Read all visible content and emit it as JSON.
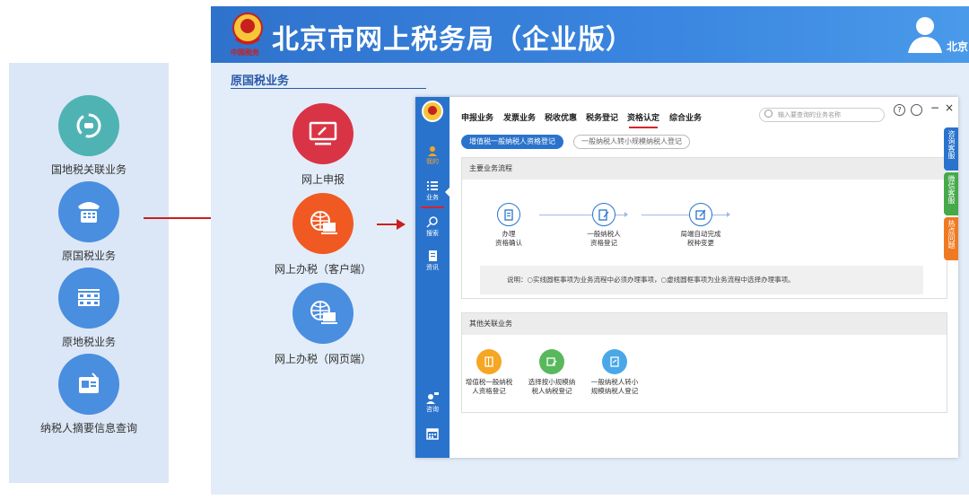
{
  "left_panel": {
    "items": [
      {
        "label": "国地税关联业务",
        "icon": "link-arrows-icon",
        "color": "#4fb3b3"
      },
      {
        "label": "原国税业务",
        "icon": "phone-keypad-icon",
        "color": "#4a8ee0"
      },
      {
        "label": "原地税业务",
        "icon": "grid-icon",
        "color": "#4a8ee0"
      },
      {
        "label": "纳税人摘要信息查询",
        "icon": "id-card-icon",
        "color": "#4a8ee0"
      }
    ]
  },
  "portal": {
    "title": "北京市网上税务局（企业版）",
    "emblem_text": "中国税务",
    "user_name": "北京",
    "section_label": "原国税业务",
    "options": [
      {
        "label": "网上申报",
        "icon": "monitor-pen-icon",
        "color": "#d93445"
      },
      {
        "label": "网上办税（客户端）",
        "icon": "globe-laptop-icon",
        "color": "#f05a22"
      },
      {
        "label": "网上办税（网页端）",
        "icon": "globe-laptop-icon",
        "color": "#4a8ee0"
      }
    ]
  },
  "client": {
    "sidebar": [
      {
        "label": "我的",
        "icon": "user-signal-icon"
      },
      {
        "label": "业务",
        "icon": "list-icon"
      },
      {
        "label": "搜索",
        "icon": "search-icon"
      },
      {
        "label": "资讯",
        "icon": "document-icon"
      },
      {
        "label": "咨询",
        "icon": "chat-user-icon"
      },
      {
        "label": "",
        "icon": "calendar-icon"
      }
    ],
    "tabs": [
      "申报业务",
      "发票业务",
      "税收优惠",
      "税务登记",
      "资格认定",
      "综合业务"
    ],
    "active_tab": "资格认定",
    "search_placeholder": "输入要查询的业务名称",
    "controls": {
      "help": "?",
      "minimize": "−",
      "close": "×"
    },
    "subtabs": [
      "增值税一般纳税人资格登记",
      "一般纳税人转小规模纳税人登记"
    ],
    "main_process": {
      "title": "主要业务流程",
      "steps": [
        {
          "label": "办理\n资格确认",
          "icon": "clipboard-icon"
        },
        {
          "label": "一般纳税人\n资格登记",
          "icon": "edit-doc-icon"
        },
        {
          "label": "局端自动完成\n税种变更",
          "icon": "edit-box-icon"
        }
      ],
      "note": "说明：○实线圆框事项为业务流程中必须办理事项，○虚线圆框事项为业务流程中选择办理事项。"
    },
    "other": {
      "title": "其他关联业务",
      "items": [
        {
          "label": "增值税一般纳税\n人资格登记",
          "icon": "book-icon",
          "color": "#f5a623"
        },
        {
          "label": "选择按小规模纳\n税人纳税登记",
          "icon": "doc-edit-icon",
          "color": "#58b85c"
        },
        {
          "label": "一般纳税人转小\n规模纳税人登记",
          "icon": "doc-icon",
          "color": "#4aa8e8"
        }
      ]
    },
    "right_tabs": [
      {
        "label": "咨询客服",
        "color": "#2a73cc"
      },
      {
        "label": "微信客服",
        "color": "#46a94a"
      },
      {
        "label": "热点问题",
        "color": "#f07a22"
      }
    ]
  }
}
